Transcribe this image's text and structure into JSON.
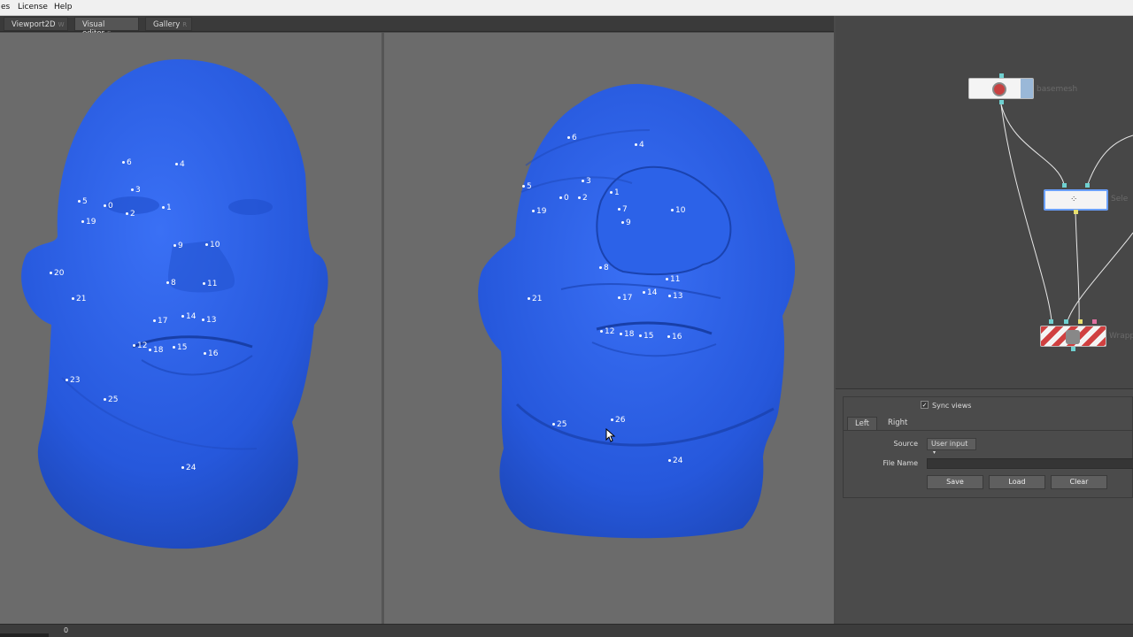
{
  "menu": {
    "items": [
      "es",
      "License",
      "Help"
    ]
  },
  "tabs": [
    {
      "label": "Viewport2D",
      "shortcut": "W"
    },
    {
      "label": "Visual editor",
      "shortcut": "E"
    },
    {
      "label": "Gallery",
      "shortcut": "R"
    }
  ],
  "left_face": {
    "color": "#2a5fe6",
    "landmarks": [
      "6",
      "4",
      "3",
      "5",
      "0",
      "2",
      "1",
      "19",
      "9",
      "10",
      "20",
      "8",
      "11",
      "21",
      "17",
      "14",
      "13",
      "12",
      "18",
      "15",
      "16",
      "23",
      "25",
      "24"
    ]
  },
  "right_face": {
    "color": "#2a5fe6",
    "landmarks": [
      "6",
      "4",
      "3",
      "5",
      "0",
      "2",
      "1",
      "19",
      "7",
      "10",
      "9",
      "8",
      "21",
      "11",
      "17",
      "14",
      "13",
      "12",
      "18",
      "15",
      "16",
      "26",
      "25",
      "24"
    ]
  },
  "nodes": [
    {
      "label": "basemesh"
    },
    {
      "label": "Sele"
    },
    {
      "label": "Wrapp"
    }
  ],
  "props": {
    "sync_views_label": "Sync views",
    "sync_views_checked": "✓",
    "tabs": [
      "Left",
      "Right"
    ],
    "source_label": "Source",
    "source_value": "User input",
    "file_name_label": "File Name",
    "file_name_value": "",
    "save_label": "Save",
    "load_label": "Load",
    "clear_label": "Clear"
  },
  "status": {
    "value": "0"
  }
}
